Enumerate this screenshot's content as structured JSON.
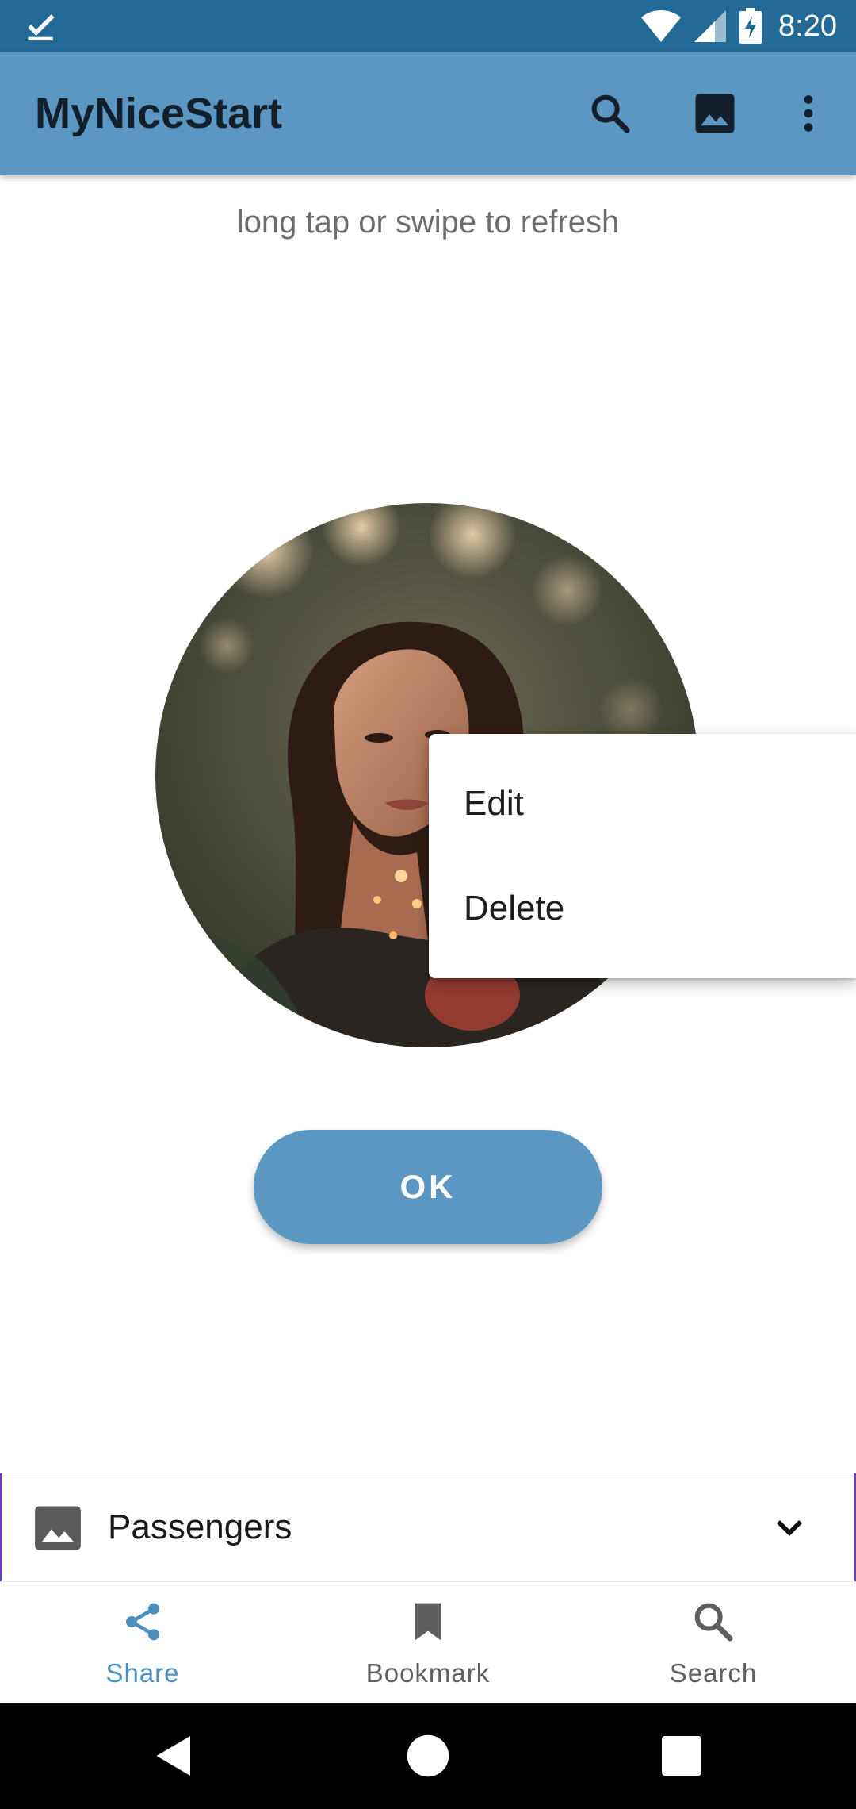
{
  "status_bar": {
    "time": "8:20",
    "left_icon": "check-icon",
    "icons": [
      "wifi-icon",
      "signal-icon",
      "battery-charging-icon"
    ]
  },
  "app_bar": {
    "title": "MyNiceStart",
    "actions": [
      "search-icon",
      "image-icon",
      "more-vert-icon"
    ],
    "color": "#5b97c2"
  },
  "main": {
    "hint": "long tap or swipe to refresh",
    "image_icon": "portrait-photo",
    "ok_label": "OK"
  },
  "popup_menu": {
    "items": [
      {
        "label": "Edit"
      },
      {
        "label": "Delete"
      }
    ]
  },
  "dropdown": {
    "icon": "image-icon",
    "selected": "Passengers",
    "chevron": "chevron-down-icon"
  },
  "bottom_nav": {
    "active_color": "#4c8fc0",
    "inactive_color": "#5f5f5f",
    "items": [
      {
        "label": "Share",
        "icon": "share-icon",
        "active": true
      },
      {
        "label": "Bookmark",
        "icon": "bookmark-icon",
        "active": false
      },
      {
        "label": "Search",
        "icon": "search-icon",
        "active": false
      }
    ]
  },
  "system_nav": {
    "buttons": [
      "back-icon",
      "home-icon",
      "recents-icon"
    ]
  }
}
